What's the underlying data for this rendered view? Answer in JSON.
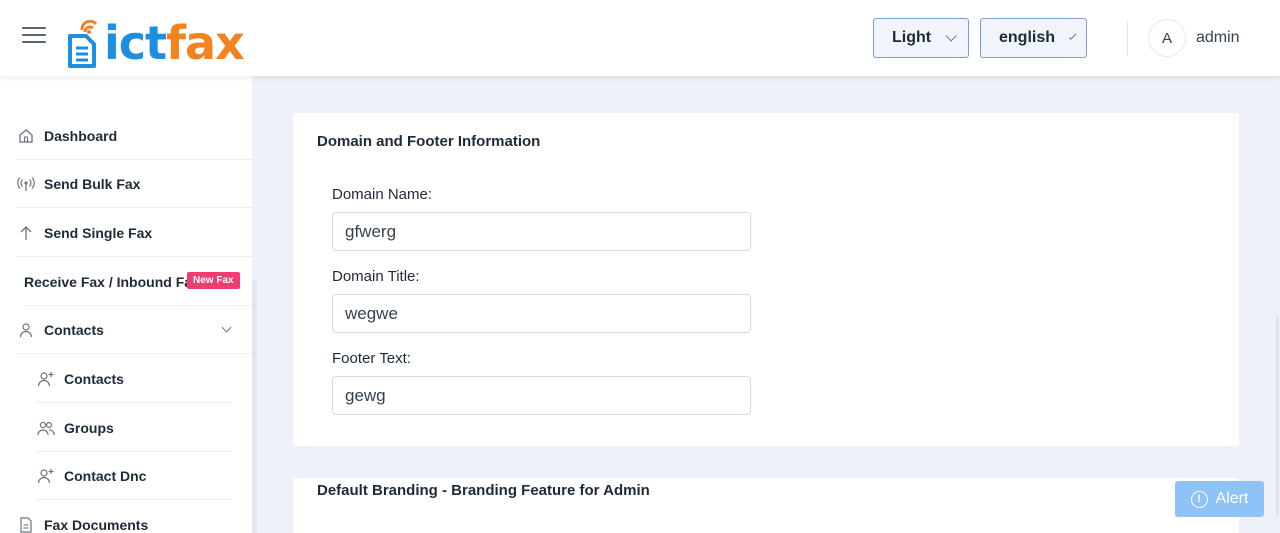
{
  "header": {
    "logo": {
      "part1": "ict",
      "part2": "fax"
    },
    "theme_select": "Light",
    "language_select": "english",
    "avatar_initial": "A",
    "username": "admin"
  },
  "sidebar": {
    "items": [
      {
        "label": "Dashboard",
        "icon": "home-icon"
      },
      {
        "label": "Send Bulk Fax",
        "icon": "broadcast-icon"
      },
      {
        "label": "Send Single Fax",
        "icon": "arrow-up-icon"
      },
      {
        "label": "Receive Fax / Inbound Fax",
        "badge": "New Fax"
      },
      {
        "label": "Contacts",
        "icon": "user-icon"
      },
      {
        "label": "Contacts",
        "icon": "user-plus-icon"
      },
      {
        "label": "Groups",
        "icon": "users-icon"
      },
      {
        "label": "Contact Dnc",
        "icon": "user-plus-icon"
      },
      {
        "label": "Fax Documents",
        "icon": "document-icon"
      }
    ]
  },
  "main": {
    "section1": {
      "title": "Domain and Footer Information",
      "fields": [
        {
          "label": "Domain Name:",
          "value": "gfwerg"
        },
        {
          "label": "Domain Title:",
          "value": "wegwe"
        },
        {
          "label": "Footer Text:",
          "value": "gewg"
        }
      ]
    },
    "section2": {
      "title": "Default Branding - Branding Feature for Admin"
    }
  },
  "alert_button": {
    "label": "Alert"
  },
  "colors": {
    "brand_blue": "#1c8fe3",
    "brand_orange": "#f58220",
    "badge": "#f03c70",
    "alert": "#8fc2f6"
  }
}
